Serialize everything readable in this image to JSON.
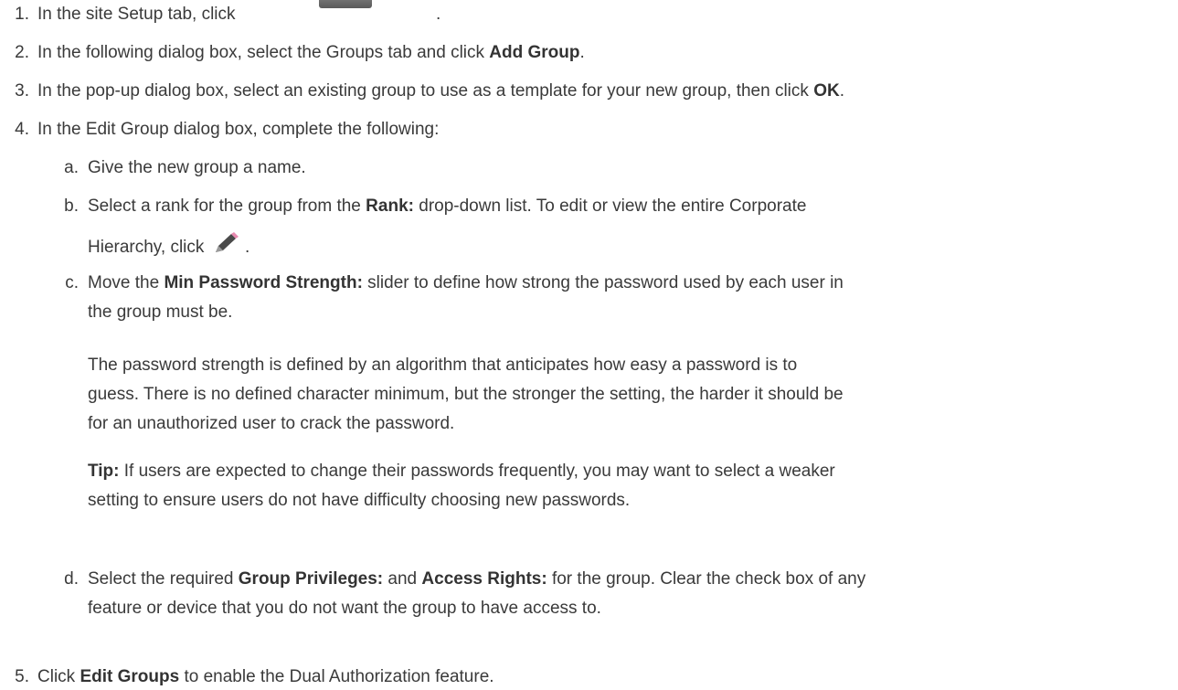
{
  "steps": [
    {
      "num": "1.",
      "text_before": "In the site Setup tab, click",
      "text_after": "."
    },
    {
      "num": "2.",
      "text_before": "In the following dialog box, select the Groups tab and click ",
      "bold": "Add Group",
      "text_after": "."
    },
    {
      "num": "3.",
      "text_before": "In the pop-up dialog box, select an existing group to use as a template for your new group, then click ",
      "bold": "OK",
      "text_after": "."
    },
    {
      "num": "4.",
      "text": "In the Edit Group dialog box, complete the following:"
    },
    {
      "num": "5.",
      "text_before": "Click ",
      "bold": "Edit Groups",
      "text_after": " to enable the Dual Authorization feature."
    }
  ],
  "substeps": {
    "a": {
      "letter": "a.",
      "text": "Give the new group a name."
    },
    "b": {
      "letter": "b.",
      "line1_before": "Select a rank for the group from the ",
      "bold": "Rank:",
      "line1_after": " drop-down list. To edit or view the entire Corporate",
      "line2": "Hierarchy, click",
      "line2_after": "."
    },
    "c": {
      "letter": "c.",
      "line1_before": "Move the ",
      "bold": "Min Password Strength:",
      "line1_after": " slider to define how strong the password used by each user in",
      "line2": "the group must be."
    },
    "d": {
      "letter": "d.",
      "line1_before": "Select the required ",
      "bold1": "Group Privileges:",
      "line1_mid": " and ",
      "bold2": "Access Rights:",
      "line1_after": " for the group. Clear the check box of any",
      "line2": "feature or device that you do not want the group to have access to."
    }
  },
  "paragraphs": {
    "strength": {
      "line1": "The password strength is defined by an algorithm that anticipates how easy a password is to",
      "line2": "guess. There is no defined character minimum, but the stronger the setting, the harder it should be",
      "line3": "for an unauthorized user to crack the password."
    },
    "tip": {
      "bold": "Tip:",
      "line1_after": " If users are expected to change their passwords frequently, you may want to select a weaker",
      "line2": "setting to ensure users do not have difficulty choosing new passwords."
    }
  },
  "icons": {
    "setup_button": "toolbar-button-image",
    "edit": "pencil-icon"
  }
}
